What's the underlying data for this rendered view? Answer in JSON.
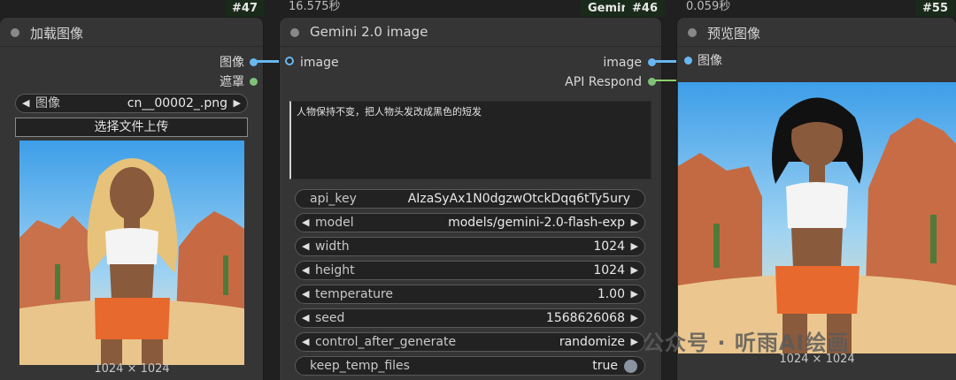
{
  "nodes": {
    "load": {
      "badge": "#47",
      "title": "加载图像",
      "outputs": [
        "图像",
        "遮罩"
      ],
      "image_widget": {
        "label": "图像",
        "value": "cn__00002_.png"
      },
      "upload_button": "选择文件上传",
      "image_size": "1024 × 1024"
    },
    "gemini": {
      "badge": "#46",
      "badge_prefix": "Gemin",
      "exec_time": "16.575秒",
      "title": "Gemini 2.0 image",
      "input": "image",
      "outputs": [
        "image",
        "API Respond"
      ],
      "prompt": "人物保持不变，把人物头发改成黑色的短发",
      "widgets": [
        {
          "label": "api_key",
          "value": "AIzaSyAx1N0dgzwOtckDqq6tTy5ury",
          "type": "text"
        },
        {
          "label": "model",
          "value": "models/gemini-2.0-flash-exp",
          "type": "combo"
        },
        {
          "label": "width",
          "value": "1024",
          "type": "number"
        },
        {
          "label": "height",
          "value": "1024",
          "type": "number"
        },
        {
          "label": "temperature",
          "value": "1.00",
          "type": "number"
        },
        {
          "label": "seed",
          "value": "1568626068",
          "type": "number"
        },
        {
          "label": "control_after_generate",
          "value": "randomize",
          "type": "combo"
        },
        {
          "label": "keep_temp_files",
          "value": "true",
          "type": "toggle"
        }
      ]
    },
    "preview": {
      "badge": "#55",
      "exec_time": "0.059秒",
      "title": "预览图像",
      "input": "图像",
      "image_size": "1024 × 1024"
    }
  },
  "watermark": "公众号 · 听雨AI绘画",
  "colors": {
    "image_slot": "#68b7f0",
    "mask_slot": "#7ec27a",
    "node_bg": "#353535",
    "canvas_bg": "#202020"
  }
}
